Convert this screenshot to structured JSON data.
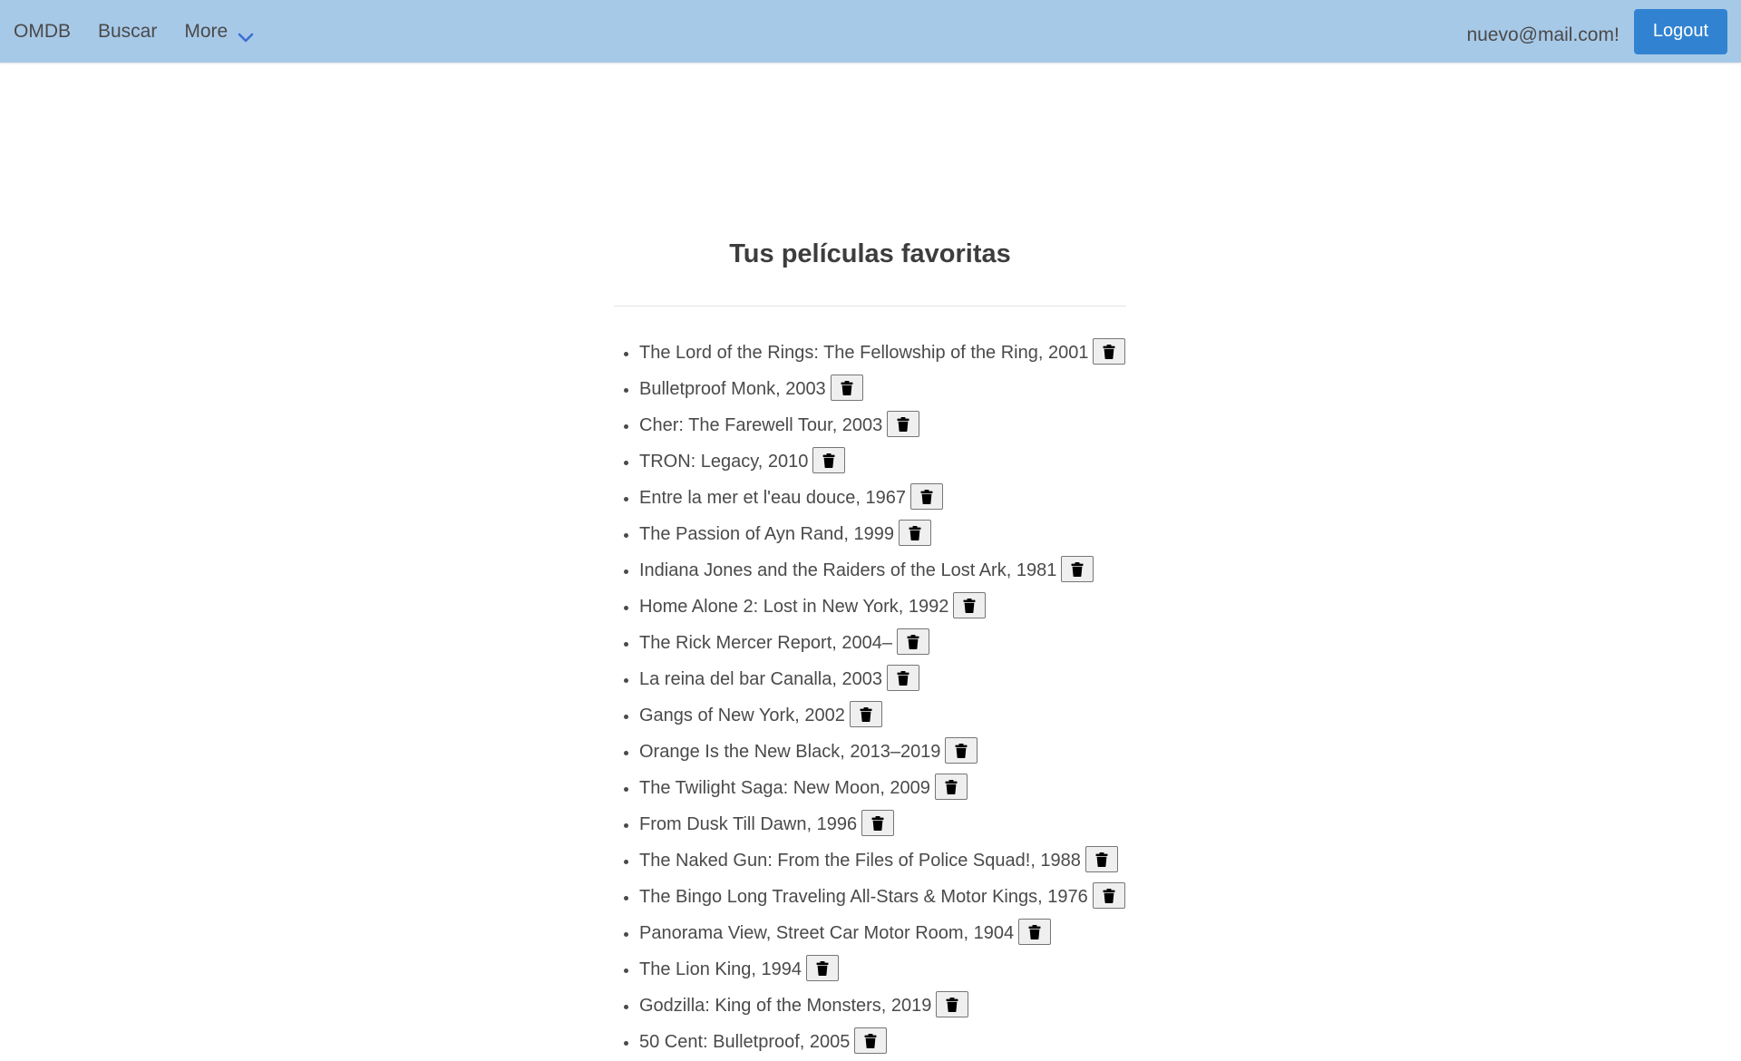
{
  "nav": {
    "brand": "OMDB",
    "search": "Buscar",
    "more": "More",
    "more_icon": "chevron-down-icon",
    "accent_color": "#3c6fd1",
    "user_email": "nuevo@mail.com!",
    "logout_label": "Logout",
    "navbar_color": "#a7c9e8",
    "logout_color": "#3183d1"
  },
  "main": {
    "title": "Tus películas favoritas",
    "delete_icon": "trash-icon",
    "movies": [
      "The Lord of the Rings: The Fellowship of the Ring, 2001",
      "Bulletproof Monk, 2003",
      "Cher: The Farewell Tour, 2003",
      "TRON: Legacy, 2010",
      "Entre la mer et l'eau douce, 1967",
      "The Passion of Ayn Rand, 1999",
      "Indiana Jones and the Raiders of the Lost Ark, 1981",
      "Home Alone 2: Lost in New York, 1992",
      "The Rick Mercer Report, 2004–",
      "La reina del bar Canalla, 2003",
      "Gangs of New York, 2002",
      "Orange Is the New Black, 2013–2019",
      "The Twilight Saga: New Moon, 2009",
      "From Dusk Till Dawn, 1996",
      "The Naked Gun: From the Files of Police Squad!, 1988",
      "The Bingo Long Traveling All-Stars & Motor Kings, 1976",
      "Panorama View, Street Car Motor Room, 1904",
      "The Lion King, 1994",
      "Godzilla: King of the Monsters, 2019",
      "50 Cent: Bulletproof, 2005"
    ]
  }
}
